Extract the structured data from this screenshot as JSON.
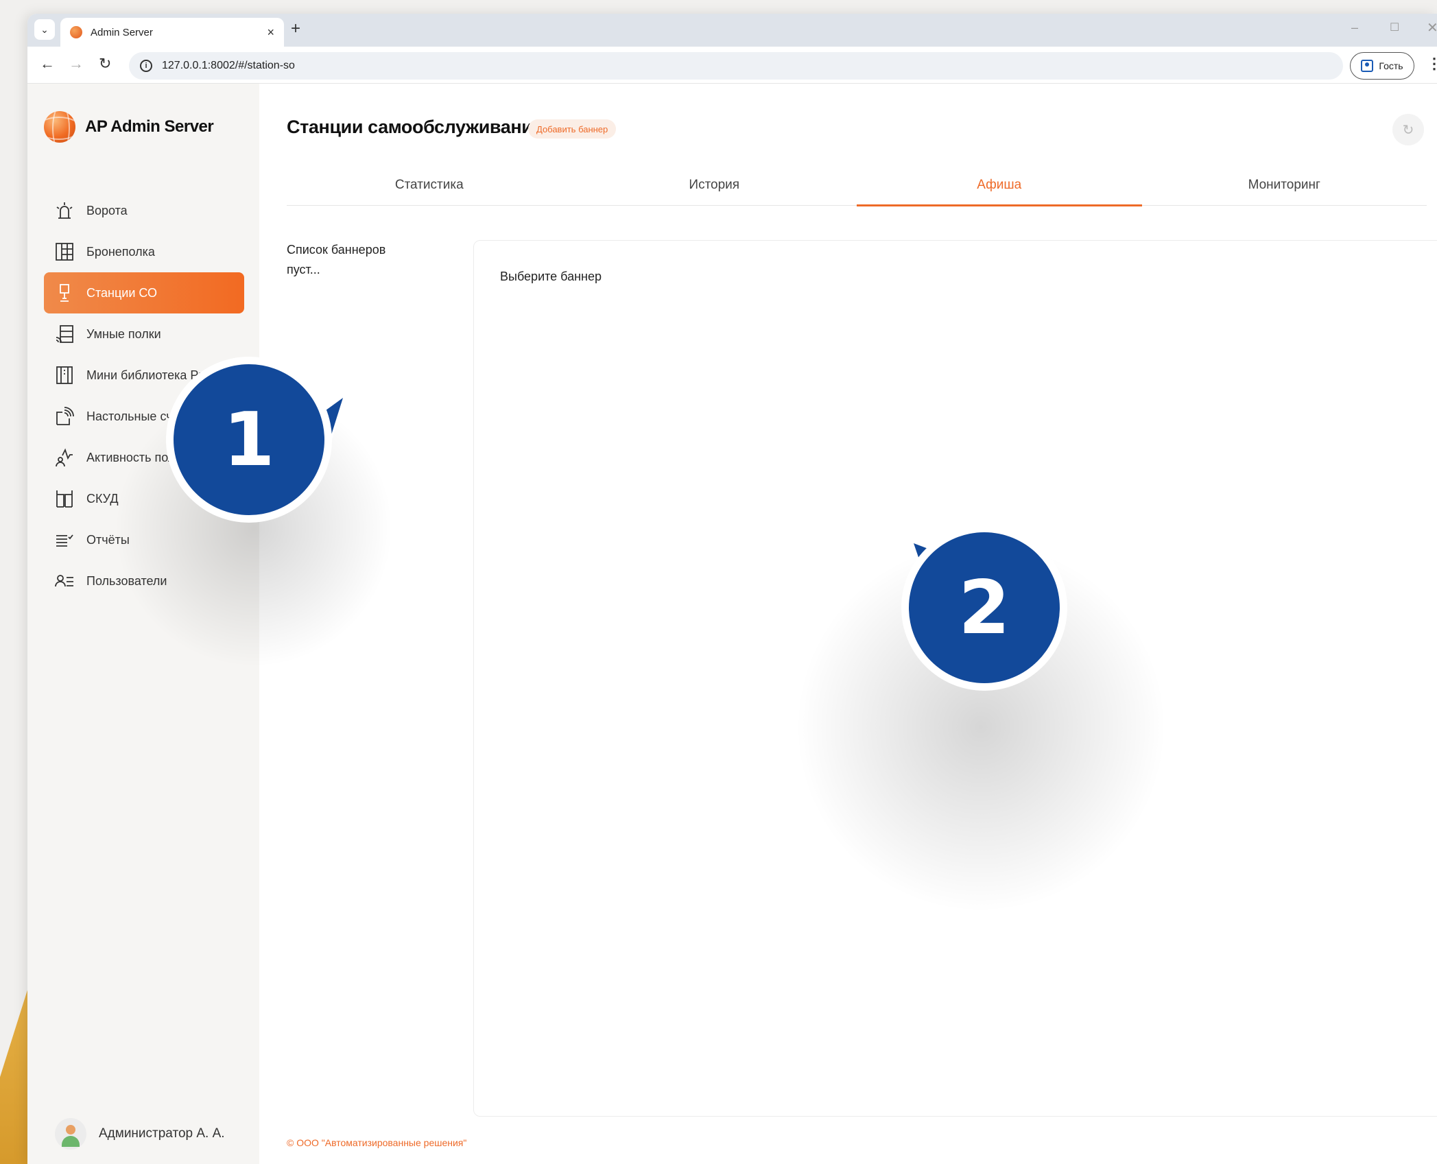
{
  "browser": {
    "tab_title": "Admin Server",
    "new_tab": "+",
    "tab_close": "×",
    "url": "127.0.0.1:8002/#/station-so",
    "profile_label": "Гость"
  },
  "sidebar": {
    "brand": "AP Admin Server",
    "items": [
      {
        "label": "Ворота",
        "icon": "gate-icon"
      },
      {
        "label": "Бронеполка",
        "icon": "grid-shelf-icon"
      },
      {
        "label": "Станции СО",
        "icon": "kiosk-icon",
        "active": true
      },
      {
        "label": "Умные полки",
        "icon": "smart-shelf-icon"
      },
      {
        "label": "Мини библиотека Pro",
        "icon": "mini-library-icon"
      },
      {
        "label": "Настольные считыватели",
        "icon": "desktop-reader-icon"
      },
      {
        "label": "Активность пользователей",
        "icon": "activity-icon"
      },
      {
        "label": "СКУД",
        "icon": "access-control-icon"
      },
      {
        "label": "Отчёты",
        "icon": "reports-icon"
      },
      {
        "label": "Пользователи",
        "icon": "users-icon"
      }
    ],
    "user_name": "Администратор А. А."
  },
  "main": {
    "title": "Станции самообслуживания",
    "add_banner": "Добавить баннер",
    "tabs": [
      {
        "label": "Статистика"
      },
      {
        "label": "История"
      },
      {
        "label": "Афиша",
        "active": true
      },
      {
        "label": "Мониторинг"
      }
    ],
    "empty_list": "Список баннеров пуст...",
    "select_hint": "Выберите баннер",
    "footer": "© ООО \"Автоматизированные решения\""
  },
  "callouts": [
    "1",
    "2"
  ],
  "colors": {
    "accent": "#ee6a28",
    "callout": "#12499a"
  }
}
